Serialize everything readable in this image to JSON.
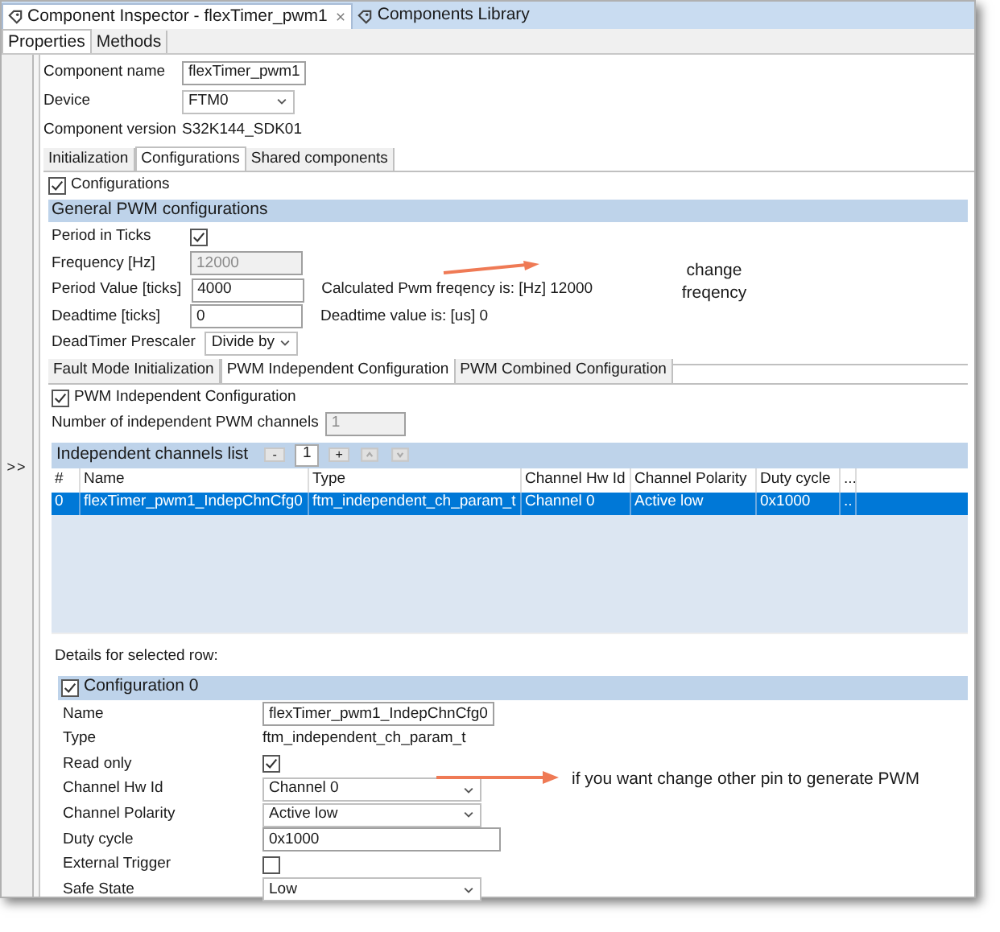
{
  "view_tabs": [
    {
      "label": "Component Inspector - flexTimer_pwm1",
      "selected": true
    },
    {
      "label": "Components Library",
      "selected": false
    }
  ],
  "property_tabs": [
    {
      "label": "Properties",
      "selected": true
    },
    {
      "label": "Methods",
      "selected": false
    }
  ],
  "collapse_glyph": ">>",
  "component_fields": [
    {
      "label": "Component name",
      "kind": "text",
      "value": "flexTimer_pwm1"
    },
    {
      "label": "Device",
      "kind": "select",
      "value": "FTM0"
    },
    {
      "label": "Component version",
      "kind": "static",
      "value": "S32K144_SDK01"
    }
  ],
  "config_tabs": [
    {
      "label": "Initialization",
      "selected": false
    },
    {
      "label": "Configurations",
      "selected": true
    },
    {
      "label": "Shared components",
      "selected": false
    }
  ],
  "configurations": {
    "label": "Configurations",
    "checked": true
  },
  "general": {
    "title": "General PWM configurations",
    "rows": [
      {
        "label": "Period in Ticks",
        "kind": "checkbox",
        "checked": true
      },
      {
        "label": "Frequency [Hz]",
        "kind": "text",
        "value": "12000",
        "disabled": true
      },
      {
        "label": "Period Value [ticks]",
        "kind": "text",
        "value": "4000",
        "disabled": false,
        "note": "Calculated Pwm freqency is: [Hz] 12000"
      },
      {
        "label": "Deadtime [ticks]",
        "kind": "text",
        "value": "0",
        "disabled": false,
        "note": "Deadtime value is: [us] 0"
      },
      {
        "label": "DeadTimer Prescaler",
        "kind": "select",
        "value": "Divide by"
      }
    ]
  },
  "pwm_tabs": [
    {
      "label": "Fault Mode Initialization",
      "selected": false
    },
    {
      "label": "PWM Independent Configuration",
      "selected": true
    },
    {
      "label": "PWM Combined Configuration",
      "selected": false
    }
  ],
  "independent": {
    "label": "PWM Independent Configuration",
    "checked": true
  },
  "channel_count": {
    "label": "Number of independent PWM channels",
    "value": "1",
    "disabled": true
  },
  "channels_list": {
    "title": "Independent channels list",
    "remove": "-",
    "count": "1",
    "add": "+",
    "columns": [
      "#",
      "Name",
      "Type",
      "Channel Hw Id",
      "Channel Polarity",
      "Duty cycle",
      "..."
    ],
    "rows": [
      {
        "cells": [
          "0",
          "flexTimer_pwm1_IndepChnCfg0",
          "ftm_independent_ch_param_t",
          "Channel 0",
          "Active low",
          "0x1000",
          ".."
        ],
        "selected": true
      }
    ]
  },
  "details_label": "Details for selected row:",
  "configuration_0": {
    "label": "Configuration 0",
    "checked": true,
    "rows": [
      {
        "label": "Name",
        "kind": "text",
        "value": "flexTimer_pwm1_IndepChnCfg0"
      },
      {
        "label": "Type",
        "kind": "static",
        "value": "ftm_independent_ch_param_t"
      },
      {
        "label": "Read only",
        "kind": "checkbox",
        "checked": true
      },
      {
        "label": "Channel Hw Id",
        "kind": "select",
        "value": "Channel 0"
      },
      {
        "label": "Channel Polarity",
        "kind": "select",
        "value": "Active low"
      },
      {
        "label": "Duty cycle",
        "kind": "wide_text",
        "value": "0x1000"
      },
      {
        "label": "External Trigger",
        "kind": "checkbox",
        "checked": false
      },
      {
        "label": "Safe State",
        "kind": "select",
        "value": "Low"
      }
    ]
  },
  "annotations": [
    {
      "text": "change freqency"
    },
    {
      "text": "if you want change other pin to generate PWM"
    }
  ]
}
